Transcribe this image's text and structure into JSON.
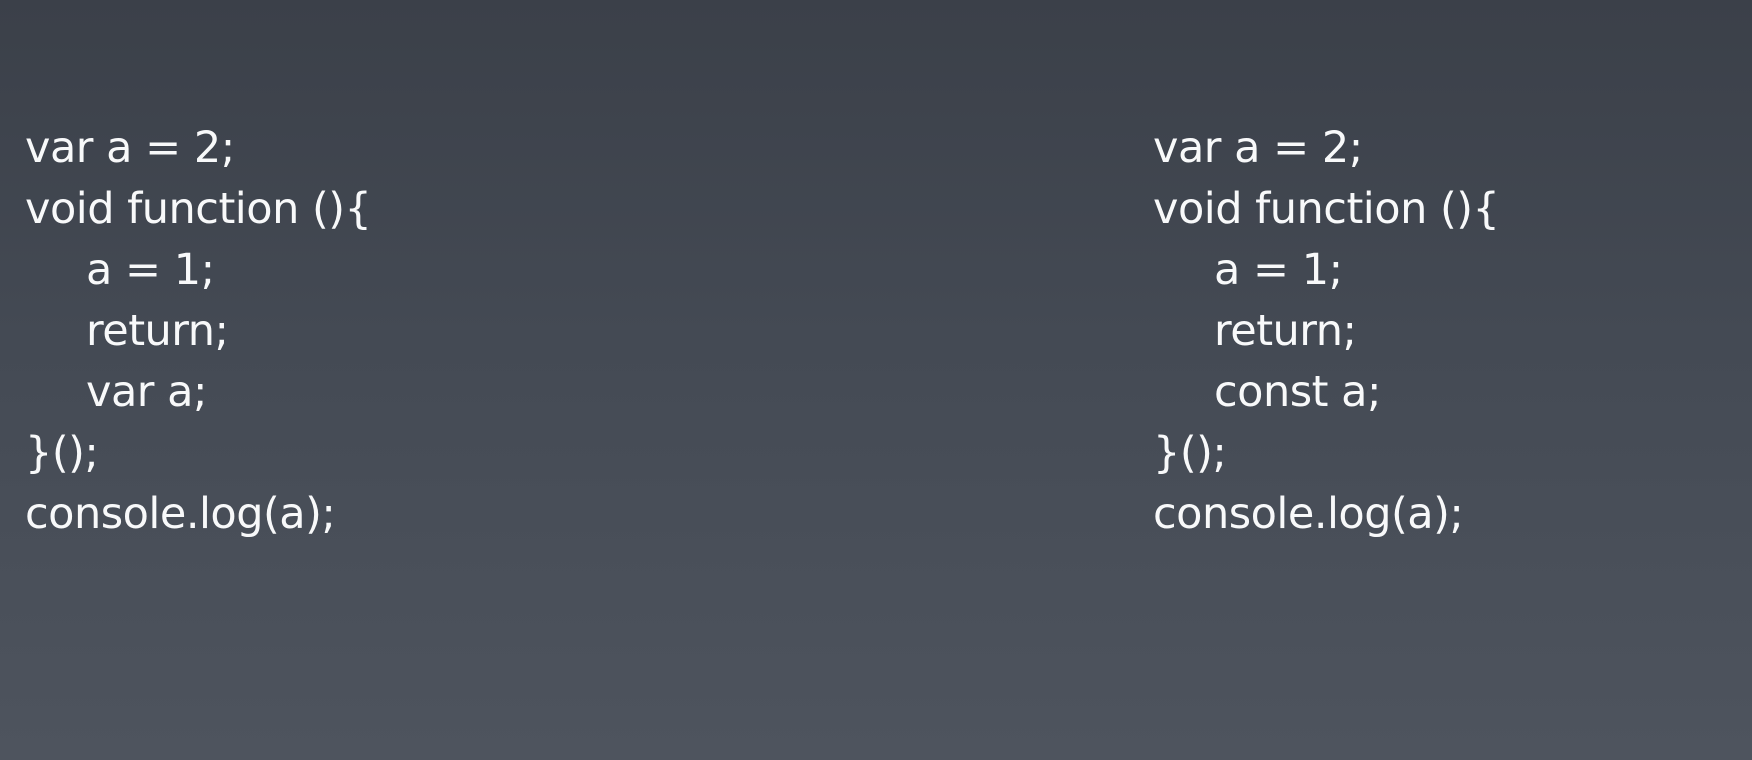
{
  "slide": {
    "left_code": {
      "lines": [
        {
          "text": "var a = 2;"
        },
        {
          "text": "void function (){"
        },
        {
          "text": "a = 1;"
        },
        {
          "text": "return;"
        },
        {
          "text": "var a;"
        },
        {
          "text": "}();"
        },
        {
          "text": "console.log(a);"
        }
      ]
    },
    "right_code": {
      "lines": [
        {
          "text": "var a = 2;"
        },
        {
          "text": "void function (){"
        },
        {
          "text": "a = 1;"
        },
        {
          "text": "return;"
        },
        {
          "text": "const a;"
        },
        {
          "text": "}();"
        },
        {
          "text": "console.log(a);"
        }
      ]
    }
  },
  "colors": {
    "background_top": "#3b4049",
    "background_bottom": "#4e545e",
    "text": "#f8f9fa"
  }
}
